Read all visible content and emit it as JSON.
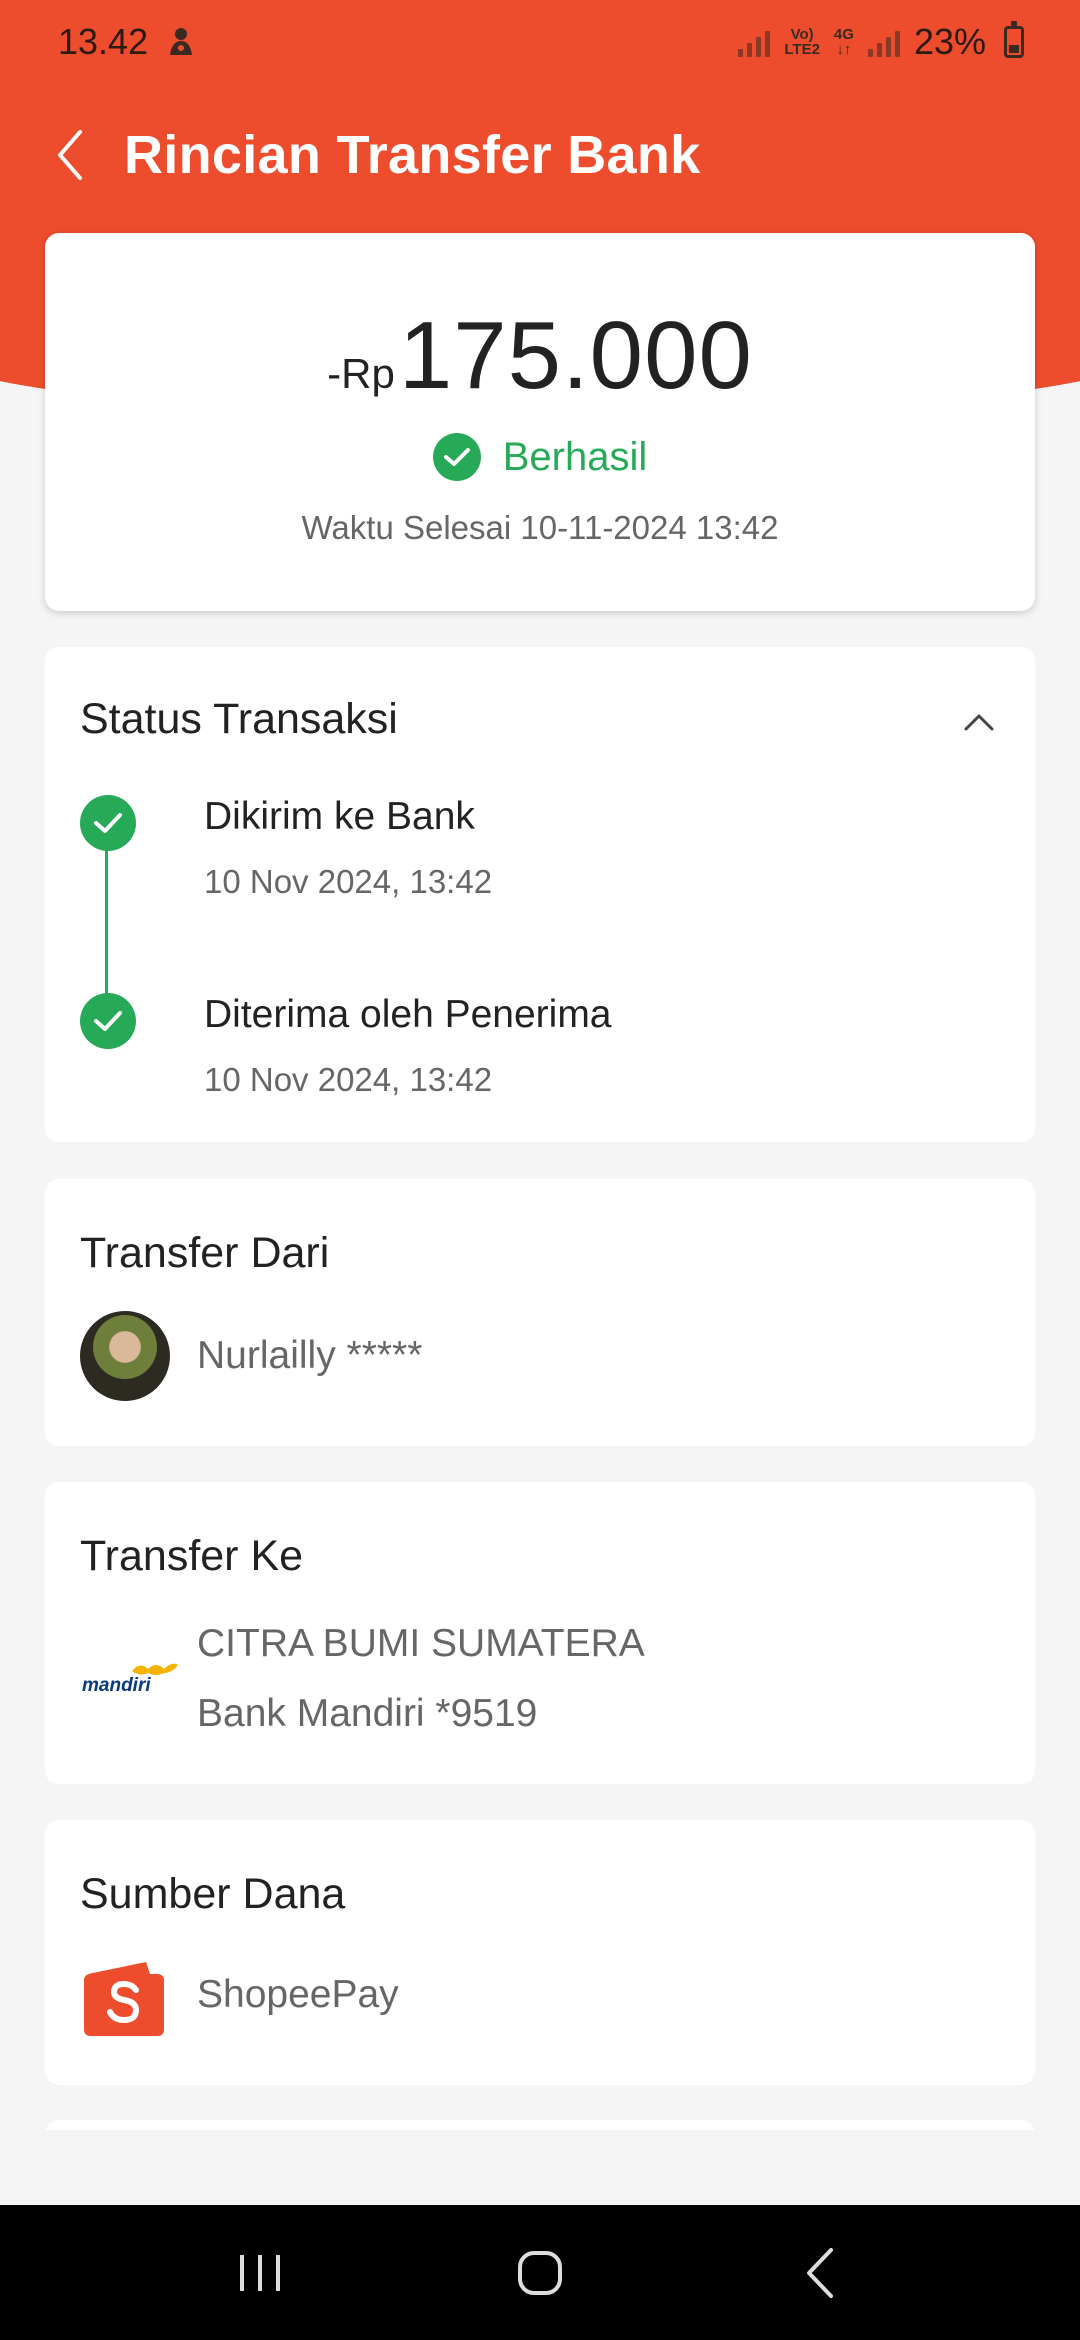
{
  "status_bar": {
    "time": "13.42",
    "network_top": "Vo)",
    "network_bottom": "LTE2",
    "network_type_top": "4G",
    "network_type_bottom": "↓↑",
    "battery": "23%"
  },
  "header": {
    "title": "Rincian Transfer Bank"
  },
  "summary": {
    "amount_prefix": "-Rp",
    "amount": "175.000",
    "status": "Berhasil",
    "finish_time": "Waktu Selesai 10-11-2024 13:42"
  },
  "transaction_status": {
    "title": "Status Transaksi",
    "steps": [
      {
        "label": "Dikirim ke Bank",
        "time": "10 Nov 2024, 13:42"
      },
      {
        "label": "Diterima oleh Penerima",
        "time": "10 Nov 2024, 13:42"
      }
    ]
  },
  "transfer_from": {
    "title": "Transfer Dari",
    "name": "Nurlailly *****"
  },
  "transfer_to": {
    "title": "Transfer Ke",
    "logo_text": "mandiri",
    "name": "CITRA BUMI SUMATERA",
    "bank": "Bank Mandiri *9519"
  },
  "fund_source": {
    "title": "Sumber Dana",
    "name": "ShopeePay"
  },
  "colors": {
    "brand": "#ee4d2d",
    "success": "#26aa57"
  }
}
